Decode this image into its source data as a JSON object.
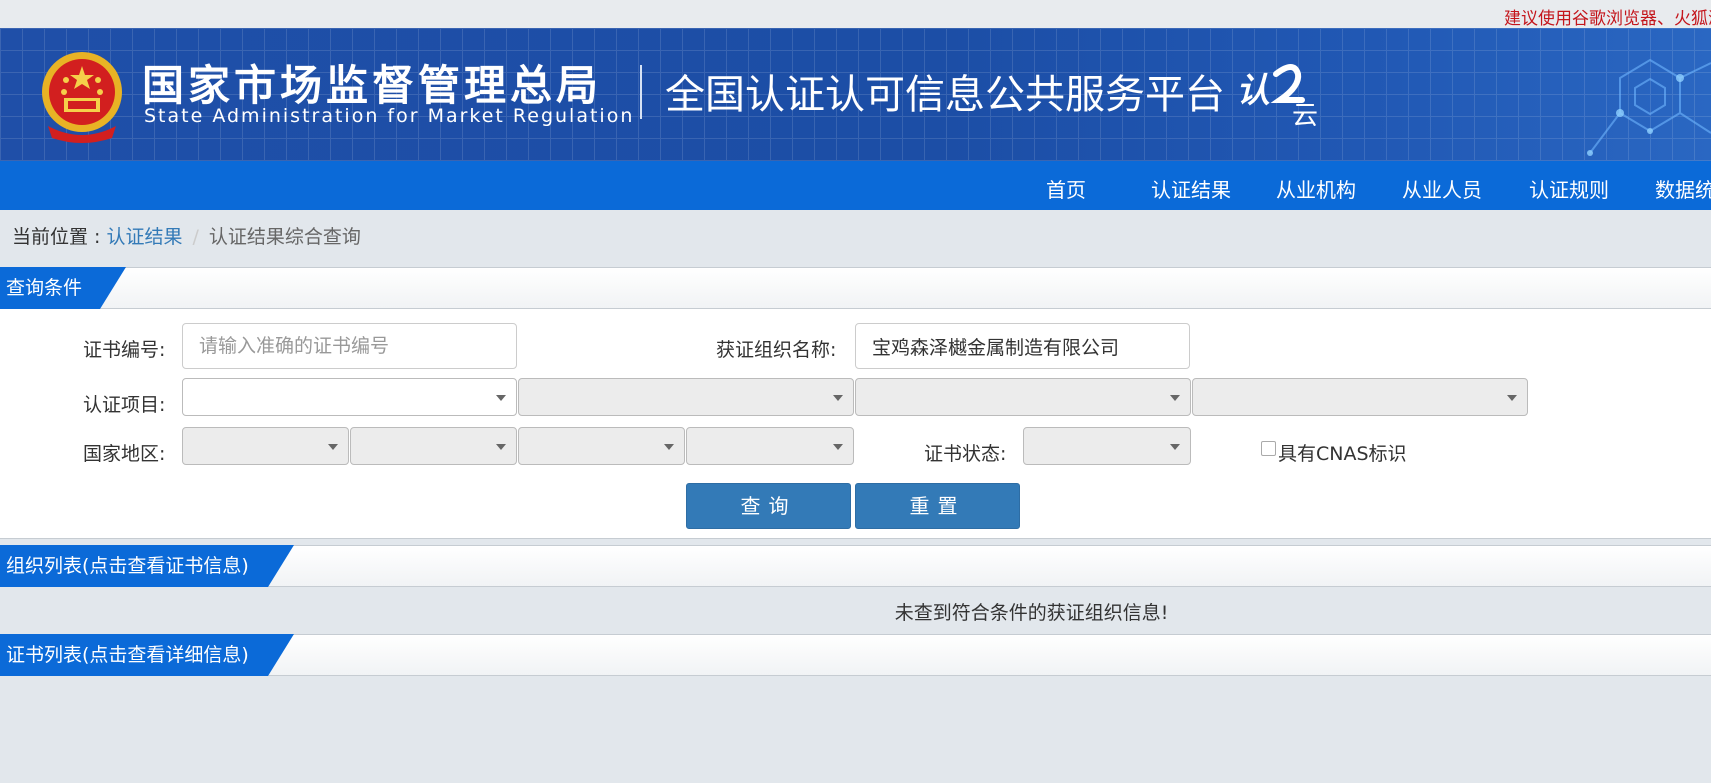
{
  "topbar": {
    "notice": "建议使用谷歌浏览器、火狐浏览器"
  },
  "header": {
    "org_cn": "国家市场监督管理总局",
    "org_en": "State Administration  for  Market Regulation",
    "platform": "全国认证认可信息公共服务平台",
    "logo_text": "认云"
  },
  "nav": {
    "items": [
      "首页",
      "认证结果",
      "从业机构",
      "从业人员",
      "认证规则",
      "数据统计"
    ]
  },
  "breadcrumb": {
    "current_label": "当前位置 : ",
    "parent": "认证结果",
    "separator": "/",
    "active": "认证结果综合查询"
  },
  "query_section": {
    "title": "查询条件"
  },
  "form": {
    "cert_no_label": "证书编号:",
    "cert_no_placeholder": "请输入准确的证书编号",
    "cert_no_value": "",
    "org_name_label": "获证组织名称:",
    "org_name_value": "宝鸡森泽樾金属制造有限公司",
    "project_label": "认证项目:",
    "region_label": "国家地区:",
    "status_label": "证书状态:",
    "cnas_label": "具有CNAS标识",
    "cnas_checked": false,
    "query_button": "查询",
    "reset_button": "重置"
  },
  "org_list": {
    "title": "组织列表(点击查看证书信息)",
    "empty_message": "未查到符合条件的获证组织信息!"
  },
  "cert_list": {
    "title": "证书列表(点击查看详细信息)"
  },
  "colors": {
    "brand_blue": "#0b6ad8",
    "header_blue": "#1f4fa8",
    "button_blue": "#337ab7",
    "notice_red": "#c4161c"
  }
}
